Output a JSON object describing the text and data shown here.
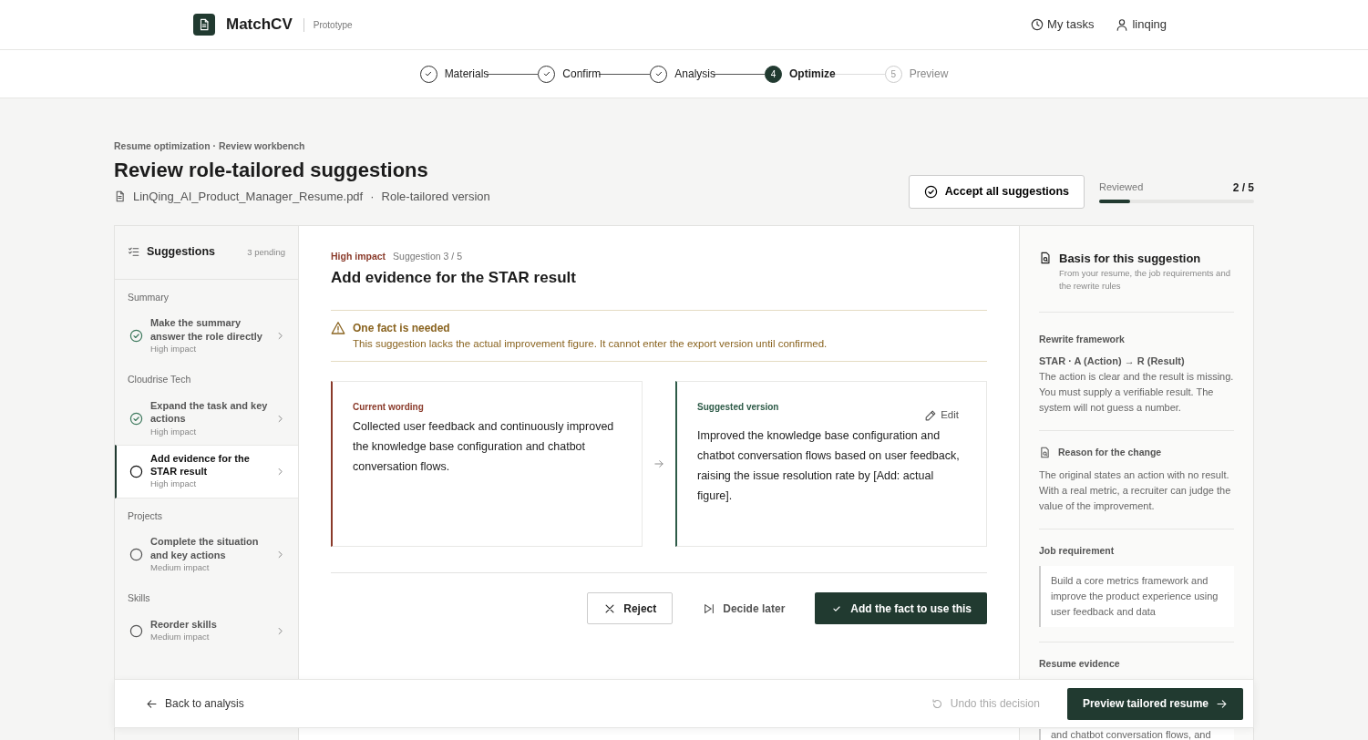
{
  "brand": {
    "name": "MatchCV",
    "tag": "Prototype"
  },
  "nav": [
    {
      "kind": "tasks",
      "label": "My tasks"
    },
    {
      "kind": "user",
      "label": "linqing"
    }
  ],
  "steps": [
    {
      "label": "Materials",
      "done": true,
      "selected": false
    },
    {
      "label": "Confirm",
      "done": true,
      "selected": false
    },
    {
      "label": "Analysis",
      "done": true,
      "selected": false
    },
    {
      "label": "Optimize",
      "done": false,
      "selected": true,
      "number": "4"
    },
    {
      "label": "Preview",
      "done": false,
      "selected": false,
      "number": "5"
    }
  ],
  "page": {
    "breadcrumb": "Resume optimization · Review workbench",
    "title": "Review role-tailored suggestions",
    "file": "LinQing_AI_Product_Manager_Resume.pdf",
    "separator": "·",
    "version": "Role-tailored version"
  },
  "accept_all": "Accept all suggestions",
  "progress": {
    "label": "Reviewed",
    "reading": "2 / 5",
    "level": 0.2
  },
  "sidebar": {
    "title": "Suggestions",
    "count": "3 pending",
    "groups": [
      {
        "title": "Summary",
        "items": [
          {
            "title": "Make the summary answer the role directly",
            "impact": "High impact",
            "done": true,
            "selected": false
          }
        ]
      },
      {
        "title": "Cloudrise Tech",
        "items": [
          {
            "title": "Expand the task and key actions",
            "impact": "High impact",
            "done": true,
            "selected": false
          },
          {
            "title": "Add evidence for the STAR result",
            "impact": "High impact",
            "done": false,
            "selected": true
          }
        ]
      },
      {
        "title": "Projects",
        "items": [
          {
            "title": "Complete the situation and key actions",
            "impact": "Medium impact",
            "done": false,
            "selected": false
          }
        ]
      },
      {
        "title": "Skills",
        "items": [
          {
            "title": "Reorder skills",
            "impact": "Medium impact",
            "done": false,
            "selected": false
          }
        ]
      }
    ]
  },
  "suggestion": {
    "impact": "High impact",
    "counter": "Suggestion 3 / 5",
    "title": "Add evidence for the STAR result",
    "alert": {
      "title": "One fact is needed",
      "text": "This suggestion lacks the actual improvement figure. It cannot enter the export version until confirmed."
    },
    "current": {
      "label": "Current wording",
      "text": "Collected user feedback and continuously improved the knowledge base configuration and chatbot conversation flows."
    },
    "suggested": {
      "label": "Suggested version",
      "edit": "Edit",
      "text": "Improved the knowledge base configuration and chatbot conversation flows based on user feedback, raising the issue resolution rate by [Add: actual figure]."
    },
    "actions": [
      {
        "kind": "reject",
        "label": "Reject"
      },
      {
        "kind": "later",
        "label": "Decide later"
      },
      {
        "kind": "primary",
        "label": "Add the fact to use this"
      }
    ]
  },
  "basis": {
    "title": "Basis for this suggestion",
    "subtitle": "From your resume, the job requirements and the rewrite rules",
    "framework": {
      "label": "Rewrite framework",
      "formula": "STAR · A (Action) → R (Result)",
      "text": "The action is clear and the result is missing. You must supply a verifiable result. The system will not guess a number."
    },
    "reason": {
      "label": "Reason for the change",
      "text": "The original states an action with no result. With a real metric, a recruiter can judge the value of the improvement."
    },
    "requirement": {
      "label": "Job requirement",
      "text": "Build a core metrics framework and improve the product experience using user feedback and data"
    },
    "evidence": {
      "label": "Resume evidence",
      "text": "and chatbot conversation flows, and"
    }
  },
  "footer": {
    "back": "Back to analysis",
    "undo": "Undo this decision",
    "undo_disabled": true,
    "preview": "Preview tailored resume"
  }
}
